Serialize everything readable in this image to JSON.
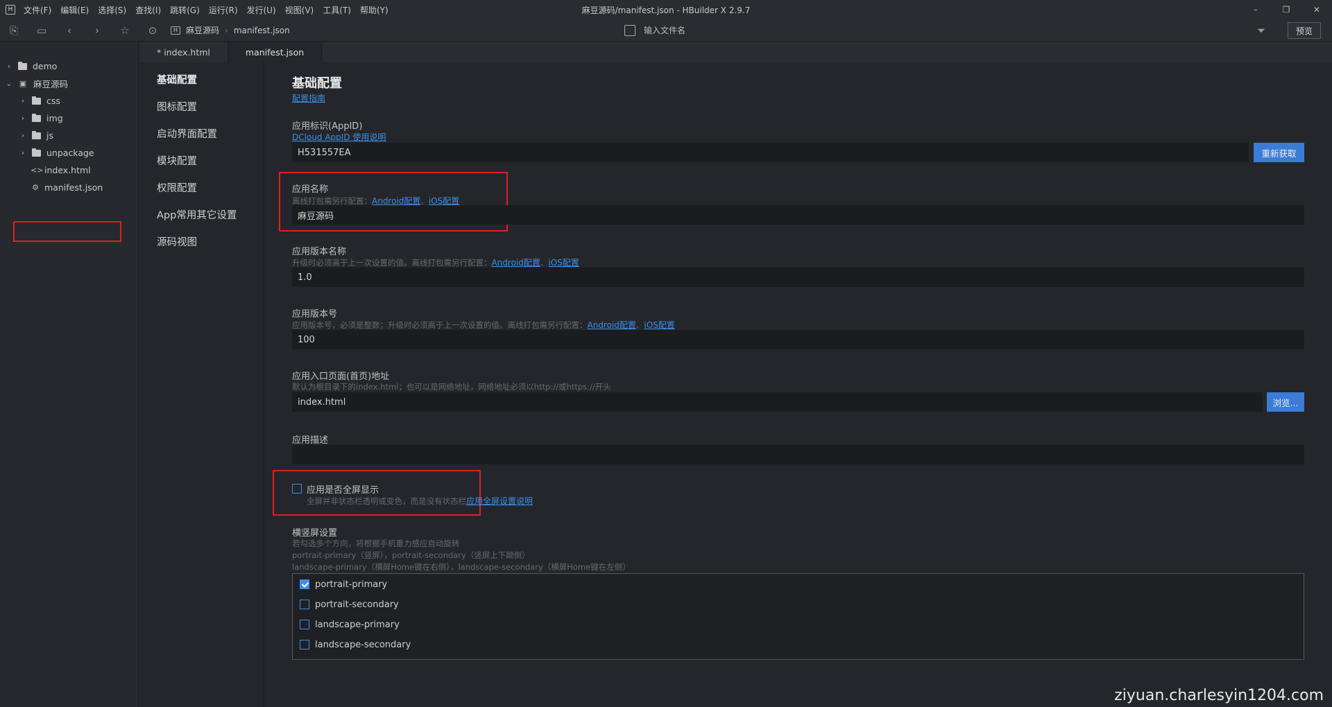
{
  "menu": [
    "文件(F)",
    "编辑(E)",
    "选择(S)",
    "查找(I)",
    "跳转(G)",
    "运行(R)",
    "发行(U)",
    "视图(V)",
    "工具(T)",
    "帮助(Y)"
  ],
  "window_title": "麻豆源码/manifest.json - HBuilder X 2.9.7",
  "app_logo": "H",
  "win_controls": {
    "minimize": "–",
    "restore": "❐",
    "close": "✕"
  },
  "toolbar": {
    "breadcrumb": [
      "麻豆源码",
      "manifest.json"
    ],
    "file_search_placeholder": "输入文件名",
    "preview_label": "预览"
  },
  "tree": {
    "items": [
      {
        "label": "demo",
        "type": "folder",
        "expanded": false,
        "depth": 0
      },
      {
        "label": "麻豆源码",
        "type": "project",
        "expanded": true,
        "depth": 0
      },
      {
        "label": "css",
        "type": "folder",
        "expanded": false,
        "depth": 1
      },
      {
        "label": "img",
        "type": "folder",
        "expanded": false,
        "depth": 1
      },
      {
        "label": "js",
        "type": "folder",
        "expanded": false,
        "depth": 1
      },
      {
        "label": "unpackage",
        "type": "folder",
        "expanded": false,
        "depth": 1
      },
      {
        "label": "index.html",
        "type": "html",
        "depth": 1
      },
      {
        "label": "manifest.json",
        "type": "json",
        "depth": 1,
        "selected": true
      }
    ]
  },
  "tabs": [
    {
      "label": "* index.html",
      "active": false
    },
    {
      "label": "manifest.json",
      "active": true
    }
  ],
  "config_nav": [
    "基础配置",
    "图标配置",
    "启动界面配置",
    "模块配置",
    "权限配置",
    "App常用其它设置",
    "源码视图"
  ],
  "form": {
    "title": "基础配置",
    "guide_link": "配置指南",
    "appid": {
      "label": "应用标识(AppID)",
      "link": "DCloud AppID 使用说明",
      "value": "H531557EA",
      "button": "重新获取"
    },
    "name": {
      "label": "应用名称",
      "hint": "离线打包需另行配置：",
      "android_link": "Android配置",
      "sep": "、",
      "ios_link": "iOS配置",
      "value": "麻豆源码"
    },
    "version_name": {
      "label": "应用版本名称",
      "hint": "升级时必须高于上一次设置的值。离线打包需另行配置：",
      "android_link": "Android配置",
      "sep": "、",
      "ios_link": "iOS配置",
      "value": "1.0"
    },
    "version_code": {
      "label": "应用版本号",
      "hint": "应用版本号，必须是整数；升级时必须高于上一次设置的值。离线打包需另行配置：",
      "android_link": "Android配置",
      "sep": "、",
      "ios_link": "iOS配置",
      "value": "100"
    },
    "entry": {
      "label": "应用入口页面(首页)地址",
      "hint": "默认为根目录下的index.html；也可以是网络地址，网络地址必须以http://或https://开头",
      "value": "index.html",
      "button": "浏览..."
    },
    "description": {
      "label": "应用描述",
      "value": ""
    },
    "fullscreen": {
      "label": "应用是否全屏显示",
      "checked": false,
      "hint": "全屏并非状态栏透明或变色，而是没有状态栏",
      "link": "应用全屏设置说明"
    },
    "orientation": {
      "label": "横竖屏设置",
      "hints": [
        "若勾选多个方向，将根据手机重力感应自动旋转",
        "portrait-primary（竖屏），portrait-secondary（竖屏上下颠倒）",
        "landscape-primary（横屏Home键在右侧），landscape-secondary（横屏Home键在左侧）"
      ],
      "options": [
        {
          "label": "portrait-primary",
          "checked": true
        },
        {
          "label": "portrait-secondary",
          "checked": false
        },
        {
          "label": "landscape-primary",
          "checked": false
        },
        {
          "label": "landscape-secondary",
          "checked": false
        }
      ]
    }
  },
  "watermark": "ziyuan.charlesyin1204.com",
  "colors": {
    "accent": "#3b7cd6",
    "link": "#3d8ee8",
    "highlight": "#e02020",
    "background": "#24262b"
  }
}
